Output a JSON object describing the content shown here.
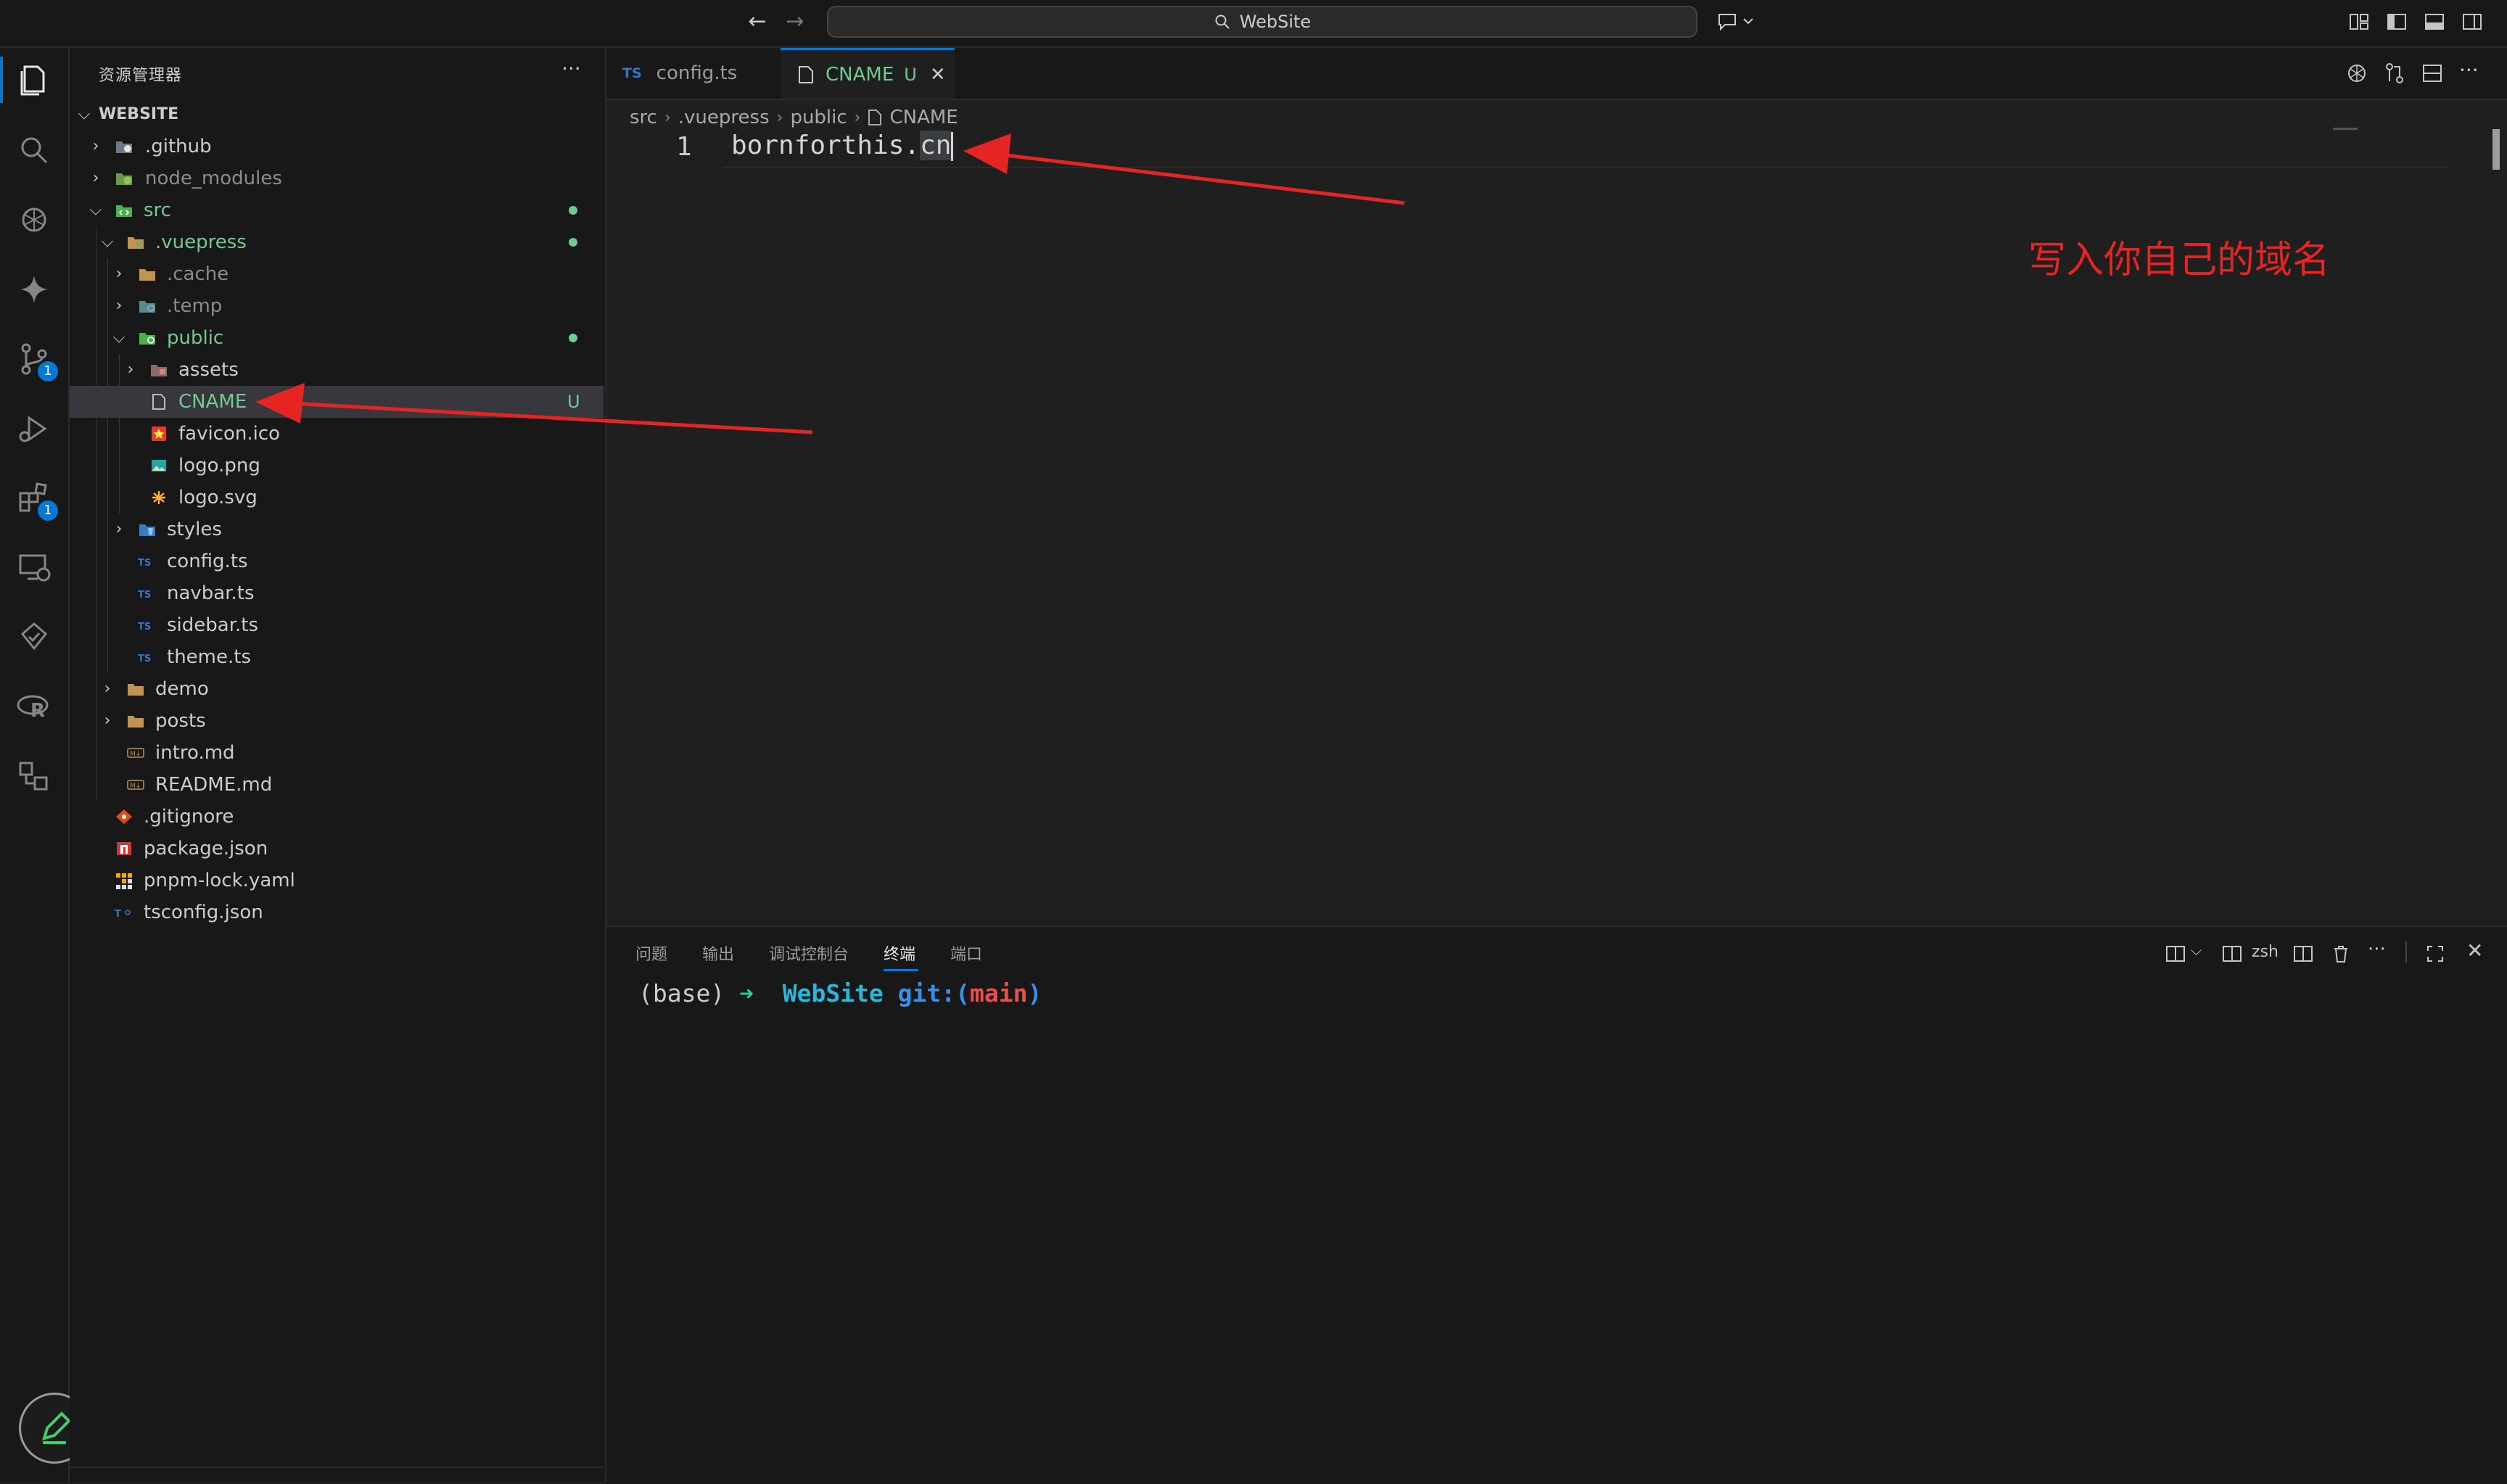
{
  "titlebar": {
    "search_text": "WebSite"
  },
  "activity_bar": {
    "items": [
      {
        "name": "explorer",
        "badge": ""
      },
      {
        "name": "search",
        "badge": ""
      },
      {
        "name": "chatgpt",
        "badge": ""
      },
      {
        "name": "gemini",
        "badge": ""
      },
      {
        "name": "source-control",
        "badge": "1"
      },
      {
        "name": "run-debug",
        "badge": ""
      },
      {
        "name": "extensions",
        "badge": "1"
      },
      {
        "name": "remote-explorer",
        "badge": ""
      },
      {
        "name": "testing",
        "badge": ""
      },
      {
        "name": "r-language",
        "badge": ""
      },
      {
        "name": "project-manager",
        "badge": ""
      }
    ]
  },
  "sidebar": {
    "title": "资源管理器",
    "more": "···",
    "root_label": "WEBSITE",
    "tree": [
      {
        "label": "src",
        "depth": 1,
        "chevron": "open",
        "icon": "folder-src",
        "color": "#73c991",
        "git": "dot"
      },
      {
        "label": ".vuepress",
        "depth": 2,
        "chevron": "open",
        "icon": "folder-vuepress",
        "color": "#73c991",
        "git": "dot"
      },
      {
        "label": ".cache",
        "depth": 3,
        "chevron": "closed",
        "icon": "folder",
        "color": "#8c8c8c",
        "git": ""
      },
      {
        "label": ".temp",
        "depth": 3,
        "chevron": "closed",
        "icon": "folder-temp",
        "color": "#8c8c8c",
        "git": ""
      },
      {
        "label": "public",
        "depth": 3,
        "chevron": "open",
        "icon": "folder-public",
        "color": "#73c991",
        "git": "dot"
      },
      {
        "label": "assets",
        "depth": 4,
        "chevron": "closed",
        "icon": "folder-assets",
        "color": "#cccccc",
        "git": ""
      },
      {
        "label": "CNAME",
        "depth": 4,
        "chevron": "",
        "icon": "file",
        "color": "#73c991",
        "git": "U",
        "selected": true
      },
      {
        "label": "favicon.ico",
        "depth": 4,
        "chevron": "",
        "icon": "favicon",
        "color": "#cccccc",
        "git": ""
      },
      {
        "label": "logo.png",
        "depth": 4,
        "chevron": "",
        "icon": "image",
        "color": "#cccccc",
        "git": ""
      },
      {
        "label": "logo.svg",
        "depth": 4,
        "chevron": "",
        "icon": "svg",
        "color": "#cccccc",
        "git": ""
      },
      {
        "label": "styles",
        "depth": 3,
        "chevron": "closed",
        "icon": "folder-styles",
        "color": "#cccccc",
        "git": ""
      },
      {
        "label": "config.ts",
        "depth": 3,
        "chevron": "",
        "icon": "ts",
        "color": "#cccccc",
        "git": ""
      },
      {
        "label": "navbar.ts",
        "depth": 3,
        "chevron": "",
        "icon": "ts",
        "color": "#cccccc",
        "git": ""
      },
      {
        "label": "sidebar.ts",
        "depth": 3,
        "chevron": "",
        "icon": "ts",
        "color": "#cccccc",
        "git": ""
      },
      {
        "label": "theme.ts",
        "depth": 3,
        "chevron": "",
        "icon": "ts",
        "color": "#cccccc",
        "git": ""
      },
      {
        "label": "demo",
        "depth": 2,
        "chevron": "closed",
        "icon": "folder",
        "color": "#cccccc",
        "git": ""
      },
      {
        "label": "posts",
        "depth": 2,
        "chevron": "closed",
        "icon": "folder",
        "color": "#cccccc",
        "git": ""
      },
      {
        "label": "intro.md",
        "depth": 2,
        "chevron": "",
        "icon": "md",
        "color": "#cccccc",
        "git": ""
      },
      {
        "label": "README.md",
        "depth": 2,
        "chevron": "",
        "icon": "md",
        "color": "#cccccc",
        "git": ""
      },
      {
        "label": ".gitignore",
        "depth": 1,
        "chevron": "",
        "icon": "git",
        "color": "#cccccc",
        "git": ""
      },
      {
        "label": "package.json",
        "depth": 1,
        "chevron": "",
        "icon": "npm",
        "color": "#cccccc",
        "git": ""
      },
      {
        "label": "pnpm-lock.yaml",
        "depth": 1,
        "chevron": "",
        "icon": "pnpm",
        "color": "#cccccc",
        "git": ""
      },
      {
        "label": "tsconfig.json",
        "depth": 1,
        "chevron": "",
        "icon": "tsconfig",
        "color": "#cccccc",
        "git": ""
      }
    ],
    "top_items": [
      {
        "label": ".github",
        "icon": "folder-github"
      },
      {
        "label": "node_modules",
        "icon": "folder-node"
      }
    ]
  },
  "editor": {
    "tabs": [
      {
        "label": "config.ts",
        "kind": "ts",
        "active": false,
        "status": ""
      },
      {
        "label": "CNAME",
        "kind": "file",
        "active": true,
        "status": "U"
      }
    ],
    "breadcrumb": [
      "src",
      ".vuepress",
      "public",
      "CNAME"
    ],
    "line_number": "1",
    "code_prefix": "bornforthis.",
    "code_selected": "cn",
    "annotation": "写入你自己的域名"
  },
  "panel": {
    "tabs": [
      "问题",
      "输出",
      "调试控制台",
      "终端",
      "端口"
    ],
    "active_tab": "终端",
    "shell": "zsh",
    "terminal": {
      "env": "(base)",
      "arrow": "➜",
      "dir": "WebSite",
      "git_label": "git:(",
      "branch": "main",
      "git_close": ")"
    }
  },
  "colors": {
    "accent": "#0078d4",
    "git_untracked": "#73c991",
    "annotation_red": "#e52424",
    "terminal_cyan": "#29b8db",
    "terminal_blue": "#3b8eea",
    "terminal_red": "#f14c4c"
  }
}
